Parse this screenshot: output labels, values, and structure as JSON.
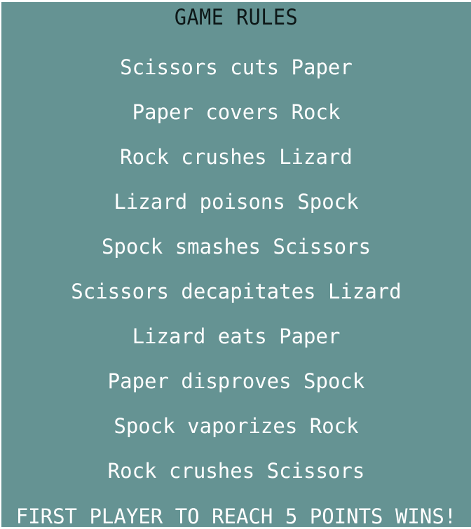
{
  "title": "GAME RULES",
  "rules": [
    "Scissors cuts Paper",
    "Paper covers Rock",
    "Rock crushes Lizard",
    "Lizard poisons Spock",
    "Spock smashes Scissors",
    "Scissors decapitates Lizard",
    "Lizard eats Paper",
    "Paper disproves Spock",
    "Spock vaporizes Rock",
    "Rock crushes Scissors"
  ],
  "footer": "FIRST PLAYER TO REACH 5 POINTS WINS!",
  "colors": {
    "background": "#659393",
    "title_text": "#0d1717",
    "rule_text": "#ffffff"
  }
}
